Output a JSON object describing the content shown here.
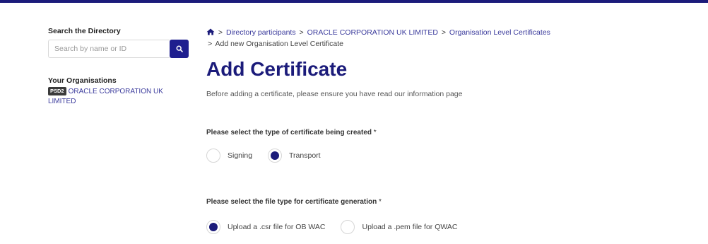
{
  "colors": {
    "brand": "#1b1b7a",
    "link": "#3a3a9c",
    "topbar": "#1b1b7a"
  },
  "sidebar": {
    "search_heading": "Search the Directory",
    "search_placeholder": "Search by name or ID",
    "search_icon": "search-icon",
    "orgs_heading": "Your Organisations",
    "org_badge": "PSD2",
    "org_name": "ORACLE CORPORATION UK LIMITED"
  },
  "breadcrumb": {
    "home_icon": "home-icon",
    "items": [
      "Directory participants",
      "ORACLE CORPORATION UK LIMITED",
      "Organisation Level Certificates"
    ],
    "current": "Add new Organisation Level Certificate",
    "separator": ">"
  },
  "page": {
    "title": "Add Certificate",
    "intro": "Before adding a certificate, please ensure you have read our information page"
  },
  "cert_type": {
    "question": "Please select the type of certificate being created",
    "required_mark": "*",
    "options": [
      {
        "label": "Signing",
        "selected": false
      },
      {
        "label": "Transport",
        "selected": true
      }
    ]
  },
  "file_type": {
    "question": "Please select the file type for certificate generation",
    "required_mark": "*",
    "options": [
      {
        "label": "Upload a .csr file for OB WAC",
        "selected": true
      },
      {
        "label": "Upload a .pem file for QWAC",
        "selected": false
      }
    ]
  }
}
